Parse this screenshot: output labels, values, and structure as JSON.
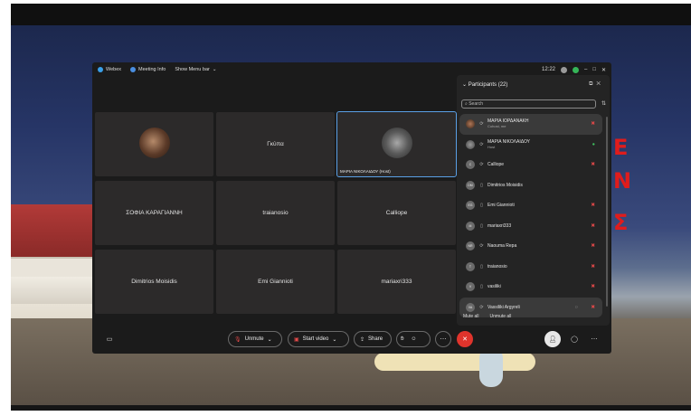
{
  "window": {
    "app_label": "Webex",
    "meeting_info_label": "Meeting Info",
    "show_menu_bar_label": "Show Menu bar",
    "time": "12:22"
  },
  "grid": {
    "tiles": [
      {
        "name": "",
        "caption": ""
      },
      {
        "name": "Γκύπα",
        "caption": ""
      },
      {
        "name": "",
        "caption": "ΜΑΡΙΑ ΝΙΚΟΛΑΙΔΟΥ (Host)"
      },
      {
        "name": "ΣΟΦΙΑ ΚΑΡΑΓΙΑΝΝΗ",
        "caption": ""
      },
      {
        "name": "traianosio",
        "caption": ""
      },
      {
        "name": "Calliope",
        "caption": ""
      },
      {
        "name": "Dimitrios Moisidis",
        "caption": ""
      },
      {
        "name": "Emi Giannioti",
        "caption": ""
      },
      {
        "name": "mariaxri333",
        "caption": ""
      }
    ]
  },
  "participants": {
    "title": "Participants (22)",
    "search_placeholder": "Search",
    "items": [
      {
        "initials": "",
        "name": "ΜΑΡΙΑ ΙΟΡΔΑΝΑΚΗ",
        "sub": "Cohost, me"
      },
      {
        "initials": "",
        "name": "ΜΑΡΙΑ ΝΙΚΟΛΑΙΔΟΥ",
        "sub": "Host"
      },
      {
        "initials": "C",
        "name": "Calliope",
        "sub": ""
      },
      {
        "initials": "DM",
        "name": "Dimitrios Moisidis",
        "sub": ""
      },
      {
        "initials": "EG",
        "name": "Emi Giannioti",
        "sub": ""
      },
      {
        "initials": "M",
        "name": "mariaxri333",
        "sub": ""
      },
      {
        "initials": "NR",
        "name": "Naouma Repa",
        "sub": ""
      },
      {
        "initials": "T",
        "name": "traianosio",
        "sub": ""
      },
      {
        "initials": "V",
        "name": "vasiliki",
        "sub": ""
      },
      {
        "initials": "VA",
        "name": "Vassiliki Argyreli",
        "sub": ""
      }
    ],
    "mute_all": "Mute all",
    "unmute_all": "Unmute all"
  },
  "controls": {
    "unmute_label": "Unmute",
    "start_video_label": "Start video",
    "share_label": "Share"
  },
  "background": {
    "letters": [
      "Ε",
      "Ν",
      "Σ"
    ]
  }
}
